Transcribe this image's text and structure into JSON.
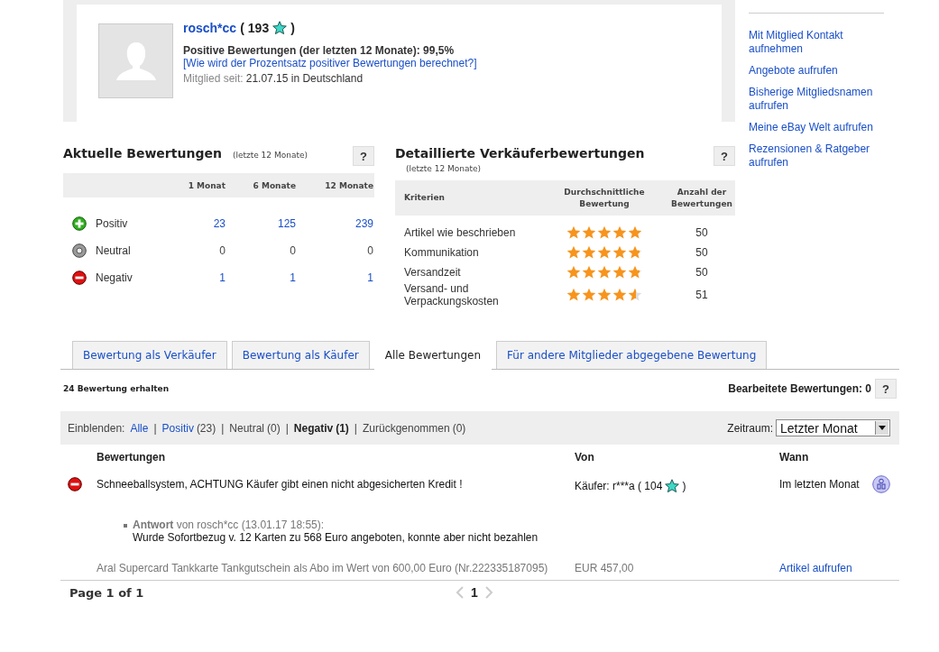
{
  "profile": {
    "username": "rosch*cc",
    "score_open": "(",
    "score": "193",
    "score_close": ")",
    "positive_label": "Positive Bewertungen (der letzten 12 Monate): 99,5%",
    "percent_link": "[Wie wird der Prozentsatz positiver Bewertungen berechnet?]",
    "member_since_label": "Mitglied seit:",
    "member_since_value": "21.07.15 in Deutschland"
  },
  "sidebar": {
    "links": [
      "Mit Mitglied Kontakt aufnehmen",
      "Angebote aufrufen",
      "Bisherige Mitgliedsnamen aufrufen",
      "Meine eBay Welt aufrufen",
      "Rezensionen & Ratgeber aufrufen"
    ]
  },
  "current": {
    "title": "Aktuelle Bewertungen",
    "subtitle": "(letzte 12 Monate)",
    "help": "?",
    "columns": [
      "1 Monat",
      "6 Monate",
      "12 Monate"
    ],
    "rows": [
      {
        "kind": "positive",
        "label": "Positiv",
        "values": [
          "23",
          "125",
          "239"
        ]
      },
      {
        "kind": "neutral",
        "label": "Neutral",
        "values": [
          "0",
          "0",
          "0"
        ]
      },
      {
        "kind": "negative",
        "label": "Negativ",
        "values": [
          "1",
          "1",
          "1"
        ]
      }
    ]
  },
  "detailed": {
    "title": "Detaillierte Verkäuferbewertungen",
    "subtitle": "(letzte 12 Monate)",
    "help": "?",
    "columns": [
      "Kriterien",
      "Durchschnittliche Bewertung",
      "Anzahl der Bewertungen"
    ],
    "rows": [
      {
        "label": "Artikel wie beschrieben",
        "stars": 4.95,
        "count": "50"
      },
      {
        "label": "Kommunikation",
        "stars": 4.85,
        "count": "50"
      },
      {
        "label": "Versandzeit",
        "stars": 4.85,
        "count": "50"
      },
      {
        "label": "Versand- und Verpackungskosten",
        "stars": 4.6,
        "count": "51"
      }
    ]
  },
  "tabs": [
    {
      "label": "Bewertung als Verkäufer",
      "selected": false
    },
    {
      "label": "Bewertung als Käufer",
      "selected": false
    },
    {
      "label": "Alle Bewertungen",
      "selected": true
    },
    {
      "label": "Für andere Mitglieder abgegebene Bewertung",
      "selected": false
    }
  ],
  "summary": {
    "received": "24 Bewertung erhalten",
    "edited": "Bearbeitete Bewertungen: 0",
    "help": "?"
  },
  "filter": {
    "label": "Einblenden:",
    "separator": "|",
    "items": [
      {
        "kind": "link",
        "label": "Alle"
      },
      {
        "kind": "link",
        "label": "Positiv",
        "count": "(23)"
      },
      {
        "kind": "plain",
        "label": "Neutral",
        "count": "(0)"
      },
      {
        "kind": "strong",
        "label": "Negativ",
        "count": "(1)"
      },
      {
        "kind": "plain",
        "label": "Zurückgenommen",
        "count": "(0)"
      }
    ],
    "period_label": "Zeitraum:",
    "period_value": "Letzter Monat"
  },
  "table": {
    "columns": [
      "Bewertungen",
      "Von",
      "Wann"
    ],
    "rows": [
      {
        "kind": "negative",
        "comment": "Schneeballsystem, ACHTUNG Käufer gibt einen nicht abgesicherten Kredit !",
        "from": "Käufer: r***a ( 104",
        "from_close": ")",
        "when": "Im letzten Monat",
        "reply": {
          "label": "Antwort",
          "meta": "von rosch*cc (13.01.17 18:55):",
          "text": "Wurde Sofortbezug v. 12 Karten zu 568 Euro angeboten, konnte aber nicht bezahlen"
        },
        "item": "Aral Supercard Tankkarte Tankgutschein als Abo im Wert von 600,00 Euro (Nr.222335187095)",
        "price": "EUR 457,00",
        "item_link": "Artikel aufrufen"
      }
    ]
  },
  "pagination": {
    "label": "Page 1 of 1",
    "current": "1"
  }
}
